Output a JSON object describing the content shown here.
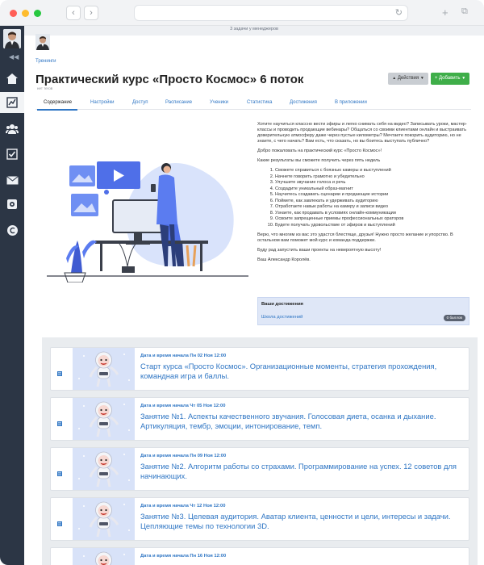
{
  "topbar": {
    "notice": "3 задачи у менеджеров"
  },
  "header": {
    "breadcrumb": "Тренинги",
    "title": "Практический курс «Просто Космос» 6 поток",
    "subtitle": "нет тегов",
    "actions_label": "Действия",
    "add_label": "Добавить"
  },
  "tabs": [
    {
      "label": "Содержание"
    },
    {
      "label": "Настройки"
    },
    {
      "label": "Доступ"
    },
    {
      "label": "Расписание"
    },
    {
      "label": "Ученики"
    },
    {
      "label": "Статистика"
    },
    {
      "label": "Достижения"
    },
    {
      "label": "В приложении"
    }
  ],
  "description": {
    "intro": "Хотите научиться классно вести эфиры и легко снимать себя на видео? Записывать уроки, мастер-классы и проводить продающие вебинары? Общаться со своими клиентами онлайн и выстраивать доверительную атмосферу даже через пустые километры? Мечтаете покорить аудиторию, но не знаете, с чего начать? Вам есть, что сказать, но вы боитесь выступать публично?",
    "welcome": "Добро пожаловать на практический курс «Просто Космос»!",
    "results_heading": "Какие результаты вы сможете получить через пять недель",
    "results": [
      "Сможете справиться с боязнью камеры и выступлений",
      "Начнете говорить грамотно и убедительно",
      "Улучшите звучание голоса и речь",
      "Создадите уникальный образ-магнит",
      "Научитесь создавать сценарии и продающие истории",
      "Поймете, как завлекать и удерживать аудиторию",
      "Отработаете навык работы на камеру и записи видео",
      "Узнаете, как продавать в условиях онлайн-коммуникации",
      "Освоите запрещенные приемы профессиональных ораторов",
      "Будете получать удовольствие от эфиров и выступлений"
    ],
    "outro": "Верю, что многим из вас это удастся блестяще, друзья! Нужно просто желание и упорство. В остальном вам поможет мой курс и команда поддержки.",
    "launch": "Буду рад запустить ваши проекты на невероятную высоту!",
    "signature": "Ваш Александр Королёв."
  },
  "achievements": {
    "title": "Ваши достижения",
    "link": "Школа достижений",
    "badge": "0 баллов"
  },
  "lessons": [
    {
      "date": "Дата и время начала Пн 02 Ноя 12:00",
      "title": "Старт курса «Просто Космос». Организационные моменты, стратегия прохождения, командная игра и баллы."
    },
    {
      "date": "Дата и время начала Чт 05 Ноя 12:00",
      "title": "Занятие №1. Аспекты качественного звучания. Голосовая диета, осанка и дыхание. Артикуляция, тембр, эмоции, интонирование, темп."
    },
    {
      "date": "Дата и время начала Пн 09 Ноя 12:00",
      "title": "Занятие №2. Алгоритм работы со страхами. Программирование на успех. 12 советов для начинающих."
    },
    {
      "date": "Дата и время начала Чт 12 Ноя 12:00",
      "title": "Занятие №3. Целевая аудитория. Аватар клиента, ценности и цели, интересы и задачи. Цепляющие темы по технологии 3D."
    },
    {
      "date": "Дата и время начала Пн 16 Ноя 12:00",
      "title": ""
    }
  ],
  "colors": {
    "accent": "#2f76c4",
    "sidebar": "#2c3645",
    "add": "#3fae49",
    "illustration": "#5b7cf0"
  }
}
